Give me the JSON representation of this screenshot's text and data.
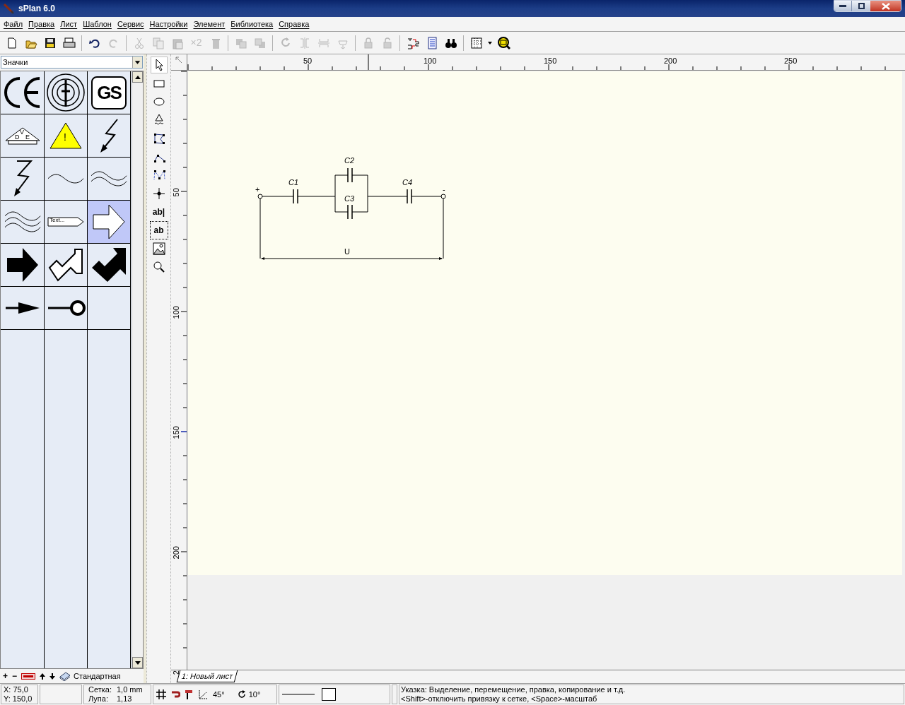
{
  "window": {
    "title": "sPlan 6.0"
  },
  "menu": [
    "Файл",
    "Правка",
    "Лист",
    "Шаблон",
    "Сервис",
    "Настройки",
    "Элемент",
    "Библиотека",
    "Справка"
  ],
  "toolbar": [
    {
      "disabled": false
    },
    {
      "disabled": false
    },
    {
      "disabled": false
    },
    {
      "disabled": false
    },
    {
      "disabled": false
    },
    {
      "disabled": true
    },
    {
      "disabled": true
    },
    {
      "disabled": true
    },
    {
      "disabled": true
    },
    {
      "disabled": true,
      "label": "×2"
    },
    {
      "disabled": true
    },
    {
      "disabled": true
    },
    {
      "disabled": true
    },
    {
      "disabled": true
    },
    {
      "disabled": true
    },
    {
      "disabled": true
    },
    {
      "disabled": true
    },
    {
      "disabled": true
    },
    {
      "disabled": true
    },
    {
      "disabled": false
    },
    {
      "disabled": false
    },
    {
      "disabled": false
    },
    {
      "disabled": false
    },
    {
      "disabled": false
    },
    {
      "disabled": false
    }
  ],
  "library": {
    "selector": "Значки",
    "symbols": [
      {
        "kind": "ce",
        "selected": false
      },
      {
        "kind": "ring",
        "selected": false
      },
      {
        "kind": "gs",
        "selected": false,
        "text": "GS"
      },
      {
        "kind": "vde",
        "selected": false,
        "letters": [
          "V",
          "D",
          "E"
        ]
      },
      {
        "kind": "warning",
        "selected": false,
        "text": "!"
      },
      {
        "kind": "bolt",
        "selected": false
      },
      {
        "kind": "bolt2",
        "selected": false
      },
      {
        "kind": "wave1",
        "selected": false
      },
      {
        "kind": "wave2",
        "selected": false
      },
      {
        "kind": "wave3",
        "selected": false
      },
      {
        "kind": "tag",
        "selected": false,
        "text": "Text..."
      },
      {
        "kind": "arrow-outline",
        "selected": true
      },
      {
        "kind": "arrow-solid",
        "selected": false
      },
      {
        "kind": "diag-outline",
        "selected": false
      },
      {
        "kind": "diag-solid",
        "selected": false
      },
      {
        "kind": "line-arrow",
        "selected": false
      },
      {
        "kind": "line-circle",
        "selected": false
      }
    ],
    "footer": {
      "plus": "+",
      "minus": "−",
      "group": "Стандартная"
    }
  },
  "tools": [
    {
      "selected": true
    },
    {
      "selected": false
    },
    {
      "selected": false
    },
    {
      "selected": false
    },
    {
      "selected": false
    },
    {
      "selected": false
    },
    {
      "selected": false
    },
    {
      "selected": false
    },
    {
      "selected": false,
      "label": "ab|"
    },
    {
      "selected": false,
      "label": "ab"
    },
    {
      "selected": false
    },
    {
      "selected": false
    }
  ],
  "rulers": {
    "horizontal": [
      "50",
      "100",
      "150",
      "200",
      "250"
    ],
    "vertical": [
      "50",
      "100",
      "150",
      "200",
      "2"
    ]
  },
  "schematic": {
    "labels": [
      "+",
      "C1",
      "C2",
      "C3",
      "C4",
      "-",
      "U"
    ]
  },
  "sheet_tabs": [
    {
      "label": "1: Новый лист",
      "selected": true
    }
  ],
  "status_bar": {
    "x": "X: 75,0",
    "y": "Y: 150,0",
    "grid_label": "Сетка:",
    "grid_value": "1,0 mm",
    "zoom_label": "Лупа:",
    "zoom_value": "1,13",
    "angle": "45°",
    "rotation": "10°",
    "hint_1": "Указка: Выделение, перемещение, правка, копирование и т.д.",
    "hint_2": "<Shift>-отключить привязку к сетке, <Space>-масштаб"
  }
}
